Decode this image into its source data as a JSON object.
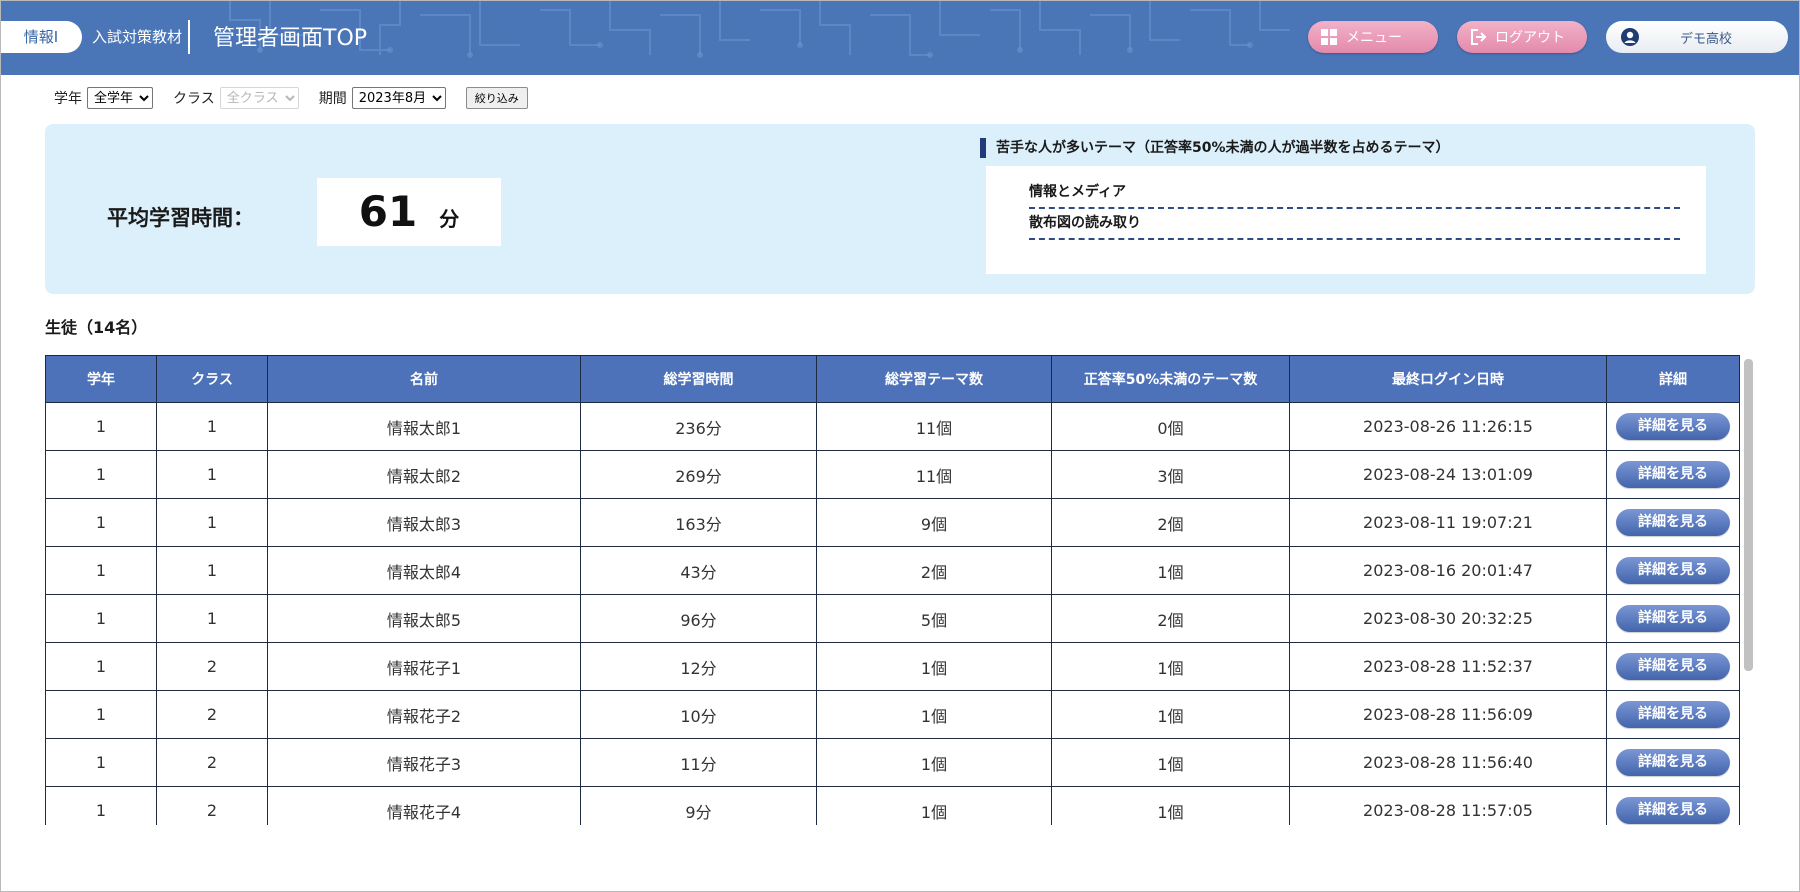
{
  "header": {
    "brand": "情報I",
    "subtitle": "入試対策教材",
    "page_title": "管理者画面TOP",
    "menu_label": "メニュー",
    "logout_label": "ログアウト",
    "user_name": "デモ高校",
    "colors": {
      "header_bg": "#4a76b8",
      "button_pink": "#e38aaa"
    }
  },
  "filters": {
    "grade_label": "学年",
    "grade_value": "全学年",
    "class_label": "クラス",
    "class_value": "全クラス",
    "period_label": "期間",
    "period_value": "2023年8月",
    "apply_label": "絞り込み"
  },
  "summary": {
    "avg_label": "平均学習時間：",
    "avg_value": "61",
    "avg_unit": "分",
    "weak_title": "苦手な人が多いテーマ（正答率50%未満の人が過半数を占めるテーマ）",
    "weak_themes": [
      "情報とメディア",
      "散布図の読み取り"
    ]
  },
  "students": {
    "title": "生徒（14名）",
    "columns": [
      "学年",
      "クラス",
      "名前",
      "総学習時間",
      "総学習テーマ数",
      "正答率50%未満のテーマ数",
      "最終ログイン日時",
      "詳細"
    ],
    "detail_label": "詳細を見る",
    "rows": [
      [
        "1",
        "1",
        "情報太郎1",
        "236分",
        "11個",
        "0個",
        "2023-08-26 11:26:15"
      ],
      [
        "1",
        "1",
        "情報太郎2",
        "269分",
        "11個",
        "3個",
        "2023-08-24 13:01:09"
      ],
      [
        "1",
        "1",
        "情報太郎3",
        "163分",
        "9個",
        "2個",
        "2023-08-11 19:07:21"
      ],
      [
        "1",
        "1",
        "情報太郎4",
        "43分",
        "2個",
        "1個",
        "2023-08-16 20:01:47"
      ],
      [
        "1",
        "1",
        "情報太郎5",
        "96分",
        "5個",
        "2個",
        "2023-08-30 20:32:25"
      ],
      [
        "1",
        "2",
        "情報花子1",
        "12分",
        "1個",
        "1個",
        "2023-08-28 11:52:37"
      ],
      [
        "1",
        "2",
        "情報花子2",
        "10分",
        "1個",
        "1個",
        "2023-08-28 11:56:09"
      ],
      [
        "1",
        "2",
        "情報花子3",
        "11分",
        "1個",
        "1個",
        "2023-08-28 11:56:40"
      ],
      [
        "1",
        "2",
        "情報花子4",
        "9分",
        "1個",
        "1個",
        "2023-08-28 11:57:05"
      ]
    ]
  }
}
